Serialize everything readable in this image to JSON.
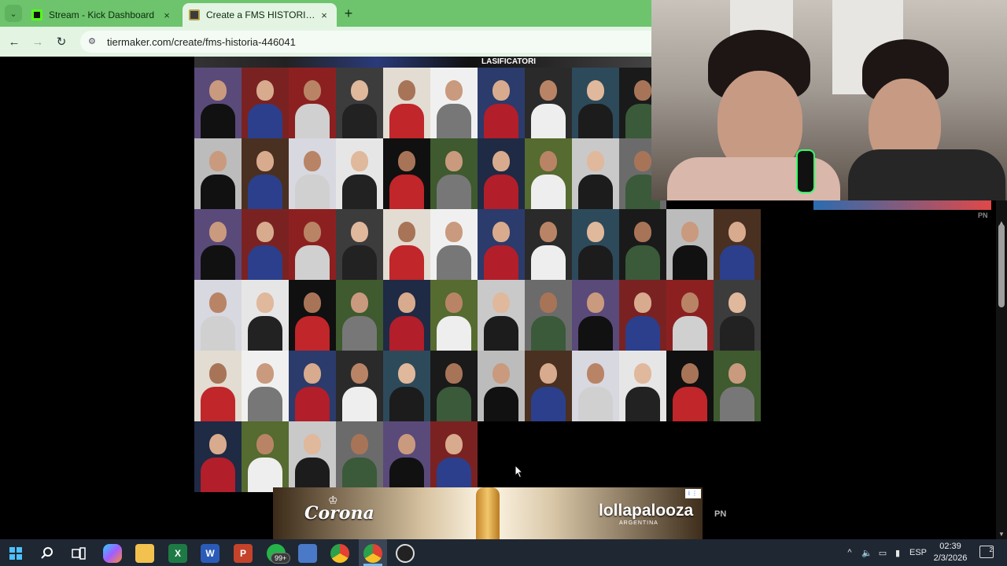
{
  "browser": {
    "tabs": [
      {
        "label": "Stream - Kick Dashboard",
        "favicon_color": "#53fc18",
        "active": false
      },
      {
        "label": "Create a FMS HISTORIA Tier List",
        "favicon_color": "#3b3b3b",
        "active": true
      }
    ],
    "new_tab_label": "+",
    "url": "tiermaker.com/create/fms-historia-446041",
    "back_label": "←",
    "forward_label": "→",
    "reload_label": "↻",
    "close_label": "×",
    "tab_menu_label": "⌄"
  },
  "page": {
    "strip_text": "LASIFICATORI",
    "pn_label": "PN"
  },
  "tier_items_count_label": "",
  "ad": {
    "brand_left": "Corona",
    "brand_right": "lollapalooza",
    "brand_right_sub": "ARGENTINA",
    "adchoices": "i ⋮",
    "pn_label": "PN"
  },
  "taskbar": {
    "whatsapp_badge": "99+",
    "tray_language": "ESP",
    "time": "02:39",
    "date": "2/3/2026",
    "notifications": "2",
    "tray_up_arrow": "^"
  },
  "colors": {
    "tab_bar": "#6dc46d",
    "toolbar": "#e3f4e3",
    "page_bg": "#000000",
    "taskbar": "#1f2733"
  }
}
